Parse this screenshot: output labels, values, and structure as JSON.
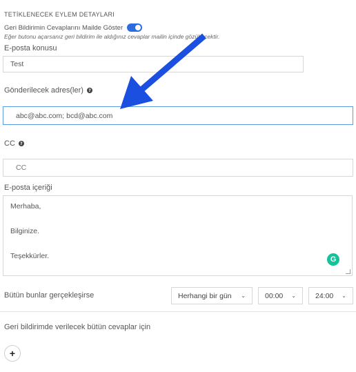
{
  "section": {
    "title": "TETİKLENECEK EYLEM DETAYLARI"
  },
  "toggle": {
    "label": "Geri Bildirimin Cevaplarını Mailde Göster",
    "on": true
  },
  "hint": "Eğer butonu açarsanız geri bildirim ile aldığınız cevaplar mailin içinde gözükecektir.",
  "subject": {
    "label": "E-posta konusu",
    "value": "Test"
  },
  "recipients": {
    "label": "Gönderilecek adres(ler)",
    "value": "abc@abc.com; bcd@abc.com"
  },
  "cc": {
    "label": "CC",
    "placeholder": "CC"
  },
  "body": {
    "label": "E-posta içeriği",
    "lines": [
      "Merhaba,",
      "",
      "Bilginize.",
      "",
      "Teşekkürler."
    ]
  },
  "condition": {
    "label": "Bütün bunlar gerçekleşirse",
    "day": "Herhangi bir gün",
    "start": "00:00",
    "end": "24:00"
  },
  "footer": {
    "label": "Geri bildirimde verilecek bütün cevaplar için",
    "add_symbol": "+"
  },
  "colors": {
    "accent": "#2d6cdf",
    "arrow": "#1a4fe0",
    "grammarly": "#15c39a"
  }
}
